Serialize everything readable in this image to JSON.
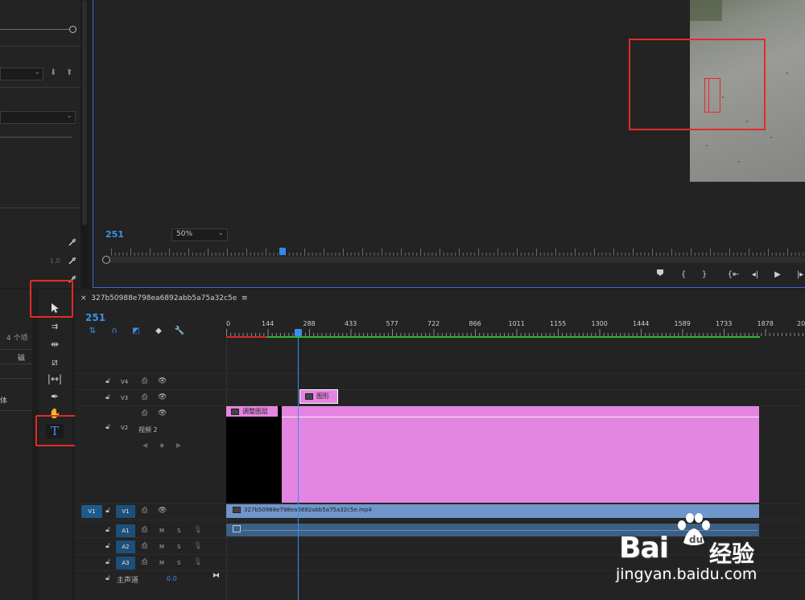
{
  "left_panel": {
    "count_label": "4 个项",
    "col_label": "磁",
    "row_label": "体",
    "scale_label": "1.0"
  },
  "monitor": {
    "timecode": "251",
    "zoom": "50%",
    "transport": [
      "mark-in",
      "open-brace",
      "close-brace",
      "go-to-in",
      "step-back",
      "play",
      "step-forward"
    ]
  },
  "sequence": {
    "close": "×",
    "name": "327b50988e798ea6892abb5a75a32c5e",
    "menu": "≡",
    "timecode": "251"
  },
  "ruler": {
    "labels": [
      "0",
      "144",
      "288",
      "433",
      "577",
      "722",
      "866",
      "1011",
      "1155",
      "1300",
      "1444",
      "1589",
      "1733",
      "1878",
      "20"
    ]
  },
  "tracks": {
    "v4": "V4",
    "v3": "V3",
    "v2": "V2",
    "v2_name": "视频 2",
    "v1_src": "V1",
    "v1": "V1",
    "a1": "A1",
    "a2": "A2",
    "a3": "A3",
    "m": "M",
    "s": "S",
    "master": "主声道",
    "master_val": "0.0"
  },
  "clips": {
    "graphic": "图形",
    "adjustment": "调整图层",
    "video": "327b50988e798ea6892abb5a75a32c5e.mp4"
  },
  "watermark": {
    "brand": "Bai",
    "brand2": "du",
    "jingyan": "经验",
    "url": "jingyan.baidu.com"
  },
  "colors": {
    "accent_blue": "#3f8fe8",
    "highlight_red": "#e32a2a",
    "clip_pink": "#e485e1",
    "clip_video": "#7096cb"
  }
}
